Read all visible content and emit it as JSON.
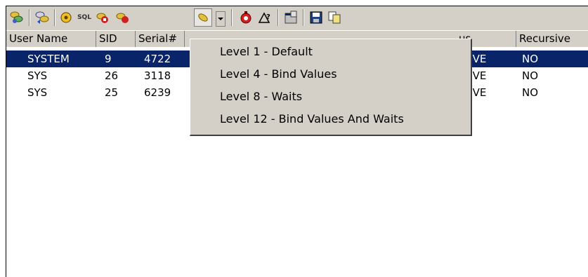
{
  "toolbar": {
    "sql_label": "SQL",
    "buttons": [
      {
        "icon": "sessions-icon"
      },
      {
        "icon": "session-refresh-icon"
      },
      {
        "icon": "disk-icon"
      },
      {
        "icon": "sql-icon"
      },
      {
        "icon": "trace-stop-icon"
      },
      {
        "icon": "trace-start-icon"
      },
      {
        "icon": "trace-level-icon"
      },
      {
        "icon": "kill-session-icon"
      },
      {
        "icon": "explain-icon"
      },
      {
        "icon": "properties-icon"
      },
      {
        "icon": "save-icon"
      },
      {
        "icon": "copy-icon"
      }
    ]
  },
  "columns": [
    "User Name",
    "SID",
    "Serial#",
    "us",
    "Recursive"
  ],
  "rows": [
    {
      "user": "SYSTEM",
      "sid": "9",
      "serial": "4722",
      "status": "TIVE",
      "recursive": "NO",
      "selected": true
    },
    {
      "user": "SYS",
      "sid": "26",
      "serial": "3118",
      "status": "TIVE",
      "recursive": "NO",
      "selected": false
    },
    {
      "user": "SYS",
      "sid": "25",
      "serial": "6239",
      "status": "TIVE",
      "recursive": "NO",
      "selected": false
    }
  ],
  "trace_menu": {
    "items": [
      "Level 1 - Default",
      "Level 4 - Bind Values",
      "Level 8 - Waits",
      "Level 12 - Bind Values And Waits"
    ]
  },
  "colors": {
    "selection": "#0a246a",
    "face": "#d4d0c8"
  }
}
